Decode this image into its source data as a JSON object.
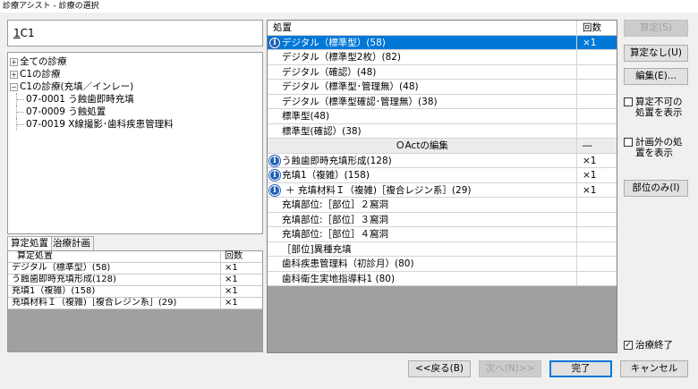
{
  "window": {
    "title": "診療アシスト - 診療の選択"
  },
  "code_input": {
    "prefix": "1",
    "value": "C1"
  },
  "tree": {
    "items": [
      {
        "label": "全ての診療",
        "expander": "+",
        "level": 0
      },
      {
        "label": "C1の診療",
        "expander": "+",
        "level": 0
      },
      {
        "label": "C1の診療(充填／インレー)",
        "expander": "−",
        "level": 0
      },
      {
        "label": "07-0001 う蝕歯即時充填",
        "level": 1
      },
      {
        "label": "07-0009 う蝕処置",
        "level": 1
      },
      {
        "label": "07-0019 X線撮影･歯科疾患管理料",
        "level": 1
      }
    ]
  },
  "tabs": [
    {
      "label": "算定処置",
      "active": true
    },
    {
      "label": "治療計画",
      "active": false
    }
  ],
  "small_table": {
    "headers": [
      "算定処置",
      "回数"
    ],
    "rows": [
      [
        "デジタル（標準型）(58)",
        "×1"
      ],
      [
        "う蝕歯即時充填形成(128)",
        "×1"
      ],
      [
        "充填1（複雑）(158)",
        "×1"
      ],
      [
        "充填材料Ｉ（複雑)［複合レジン系］(29)",
        "×1"
      ]
    ]
  },
  "grid": {
    "headers": [
      "処置",
      "回数"
    ],
    "rows": [
      {
        "label": "デジタル（標準型）(58)",
        "count": "×1",
        "info": true,
        "selected": true
      },
      {
        "label": "デジタル（標準型2枚）(82)",
        "count": ""
      },
      {
        "label": "デジタル（確認）(48)",
        "count": ""
      },
      {
        "label": "デジタル（標準型･管理無）(48)",
        "count": ""
      },
      {
        "label": "デジタル（標準型確認･管理無）(38)",
        "count": ""
      },
      {
        "label": "標準型(48)",
        "count": ""
      },
      {
        "label": "標準型(確認）(38)",
        "count": ""
      },
      {
        "label": "ＯActの編集",
        "count": "―",
        "center": true,
        "grey": true
      },
      {
        "label": "う蝕歯即時充填形成(128)",
        "count": "×1",
        "info": true,
        "noindent": true
      },
      {
        "label": "充填1（複雑）(158)",
        "count": "×1",
        "info": true,
        "noindent": true
      },
      {
        "label": "＋ 充填材料Ｉ（複雑)［複合レジン系］(29)",
        "count": "×1",
        "info": true,
        "extra": true
      },
      {
        "label": "充填部位:［部位］２窩洞",
        "count": ""
      },
      {
        "label": "充填部位:［部位］３窩洞",
        "count": ""
      },
      {
        "label": "充填部位:［部位］４窩洞",
        "count": ""
      },
      {
        "label": "［部位]異種充填",
        "count": ""
      },
      {
        "label": "歯科疾患管理料（初診月）(80)",
        "count": ""
      },
      {
        "label": "歯科衛生実地指導料1 (80)",
        "count": ""
      }
    ]
  },
  "buttons": {
    "santei": "算定(S)",
    "santei_nashi": "算定なし(U)",
    "edit": "編集(E)...",
    "bui_nomi": "部位のみ(I)",
    "back": "<<戻る(B)",
    "next": "次へ(N)>>",
    "done": "完了",
    "cancel": "キャンセル"
  },
  "checkboxes": {
    "show_unbillable": {
      "label_line1": "算定不可の",
      "label_line2": "処置を表示",
      "checked": false
    },
    "show_unplanned": {
      "label_line1": "計画外の処",
      "label_line2": "置を表示",
      "checked": false
    },
    "treatment_end": {
      "label": "治療終了",
      "checked": true
    }
  }
}
